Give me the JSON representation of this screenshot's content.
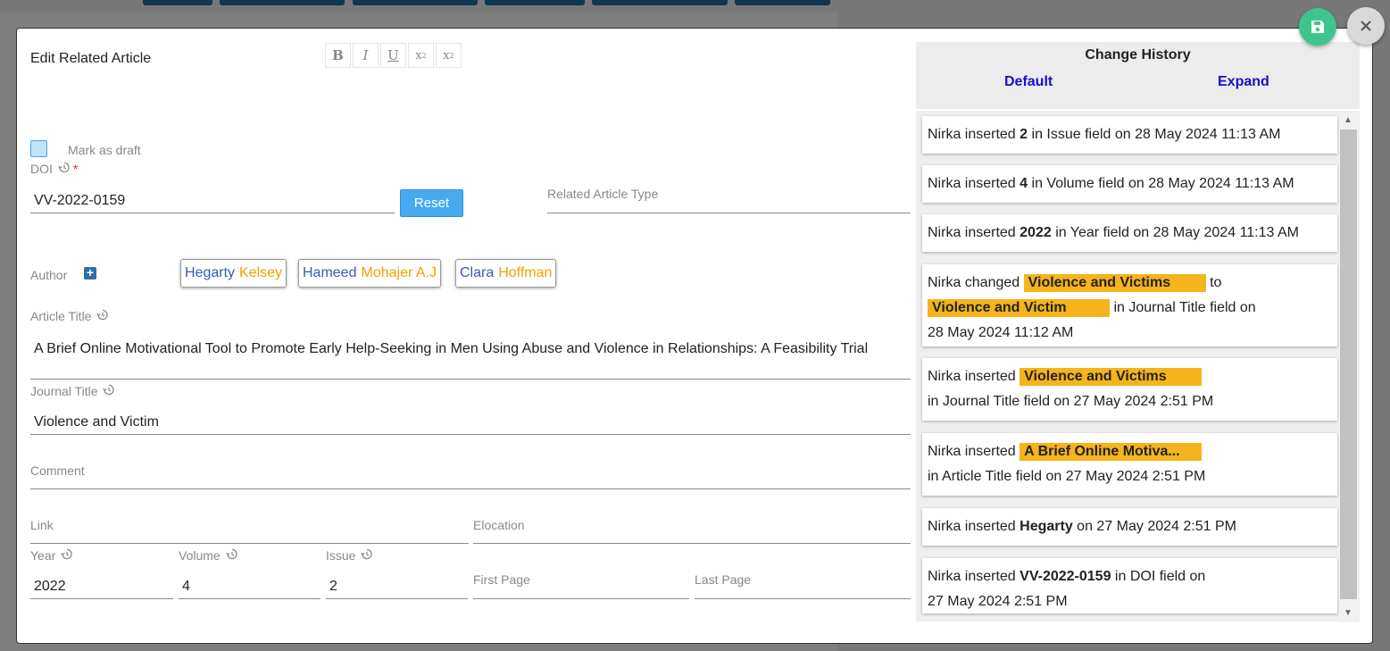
{
  "dialog": {
    "title": "Edit Related Article",
    "toolbar": [
      {
        "icon": "bold-icon",
        "glyph": "B"
      },
      {
        "icon": "italic-icon",
        "glyph": "I"
      },
      {
        "icon": "underline-icon",
        "glyph": "U"
      },
      {
        "icon": "superscript-icon",
        "glyph": "x²"
      },
      {
        "icon": "subscript-icon",
        "glyph": "x₂"
      }
    ],
    "draft_label": "Mark as draft",
    "doi": {
      "label": "DOI",
      "required_mark": "*",
      "value": "VV-2022-0159",
      "reset_label": "Reset"
    },
    "related_type": {
      "label": "Related Article Type",
      "value": ""
    },
    "author": {
      "label": "Author",
      "add_icon": "plus-icon",
      "chips": [
        {
          "given": "Hegarty",
          "surname": "Kelsey"
        },
        {
          "given": "Hameed",
          "surname": "Mohajer A.J"
        },
        {
          "given": "Clara",
          "surname": "Hoffman"
        }
      ]
    },
    "article_title": {
      "label": "Article Title",
      "value": "A Brief Online Motivational Tool to Promote Early Help-Seeking in Men Using Abuse and Violence in Relationships: A Feasibility Trial"
    },
    "journal_title": {
      "label": "Journal Title",
      "value": "Violence and Victim"
    },
    "comment": {
      "label": "Comment",
      "value": ""
    },
    "link": {
      "label": "Link",
      "value": ""
    },
    "elocation": {
      "label": "Elocation",
      "value": ""
    },
    "year": {
      "label": "Year",
      "value": "2022"
    },
    "volume": {
      "label": "Volume",
      "value": "4"
    },
    "issue": {
      "label": "Issue",
      "value": "2"
    },
    "first_page": {
      "label": "First Page",
      "value": ""
    },
    "last_page": {
      "label": "Last Page",
      "value": ""
    }
  },
  "history": {
    "title": "Change History",
    "default_label": "Default",
    "expand_label": "Expand",
    "entries": [
      {
        "line1": [
          "Nirka inserted ",
          "2",
          " in Issue field on 28 May 2024 11:13 AM"
        ]
      },
      {
        "line1": [
          "Nirka inserted ",
          "4",
          " in Volume field on 28 May 2024 11:13 AM"
        ]
      },
      {
        "line1": [
          "Nirka inserted ",
          "2022",
          " in Year field on 28 May 2024 11:13 AM"
        ]
      },
      {
        "pre": "Nirka changed",
        "old": "Violence and Victims",
        "mid": "to",
        "new": "Violence and Victim",
        "post": "in Journal Title field on",
        "date": "28 May 2024 11:12 AM"
      },
      {
        "pre": "Nirka inserted",
        "hl": "Violence and Victims",
        "post": "in Journal Title field on 27 May 2024 2:51 PM"
      },
      {
        "pre": "Nirka inserted",
        "hl": "A Brief Online Motiva...",
        "post": "in Article Title field on 27 May 2024 2:51 PM"
      },
      {
        "line1": [
          "Nirka inserted ",
          "Hegarty",
          " on 27 May 2024 2:51 PM"
        ]
      },
      {
        "line1": [
          "Nirka inserted ",
          "VV-2022-0159",
          " in DOI field on"
        ],
        "date": "27 May 2024 2:51 PM"
      }
    ]
  },
  "colors": {
    "save": "#3ec58f",
    "highlight": "#f5b41b",
    "link": "#1a0dcc",
    "reset": "#47aaf0"
  }
}
